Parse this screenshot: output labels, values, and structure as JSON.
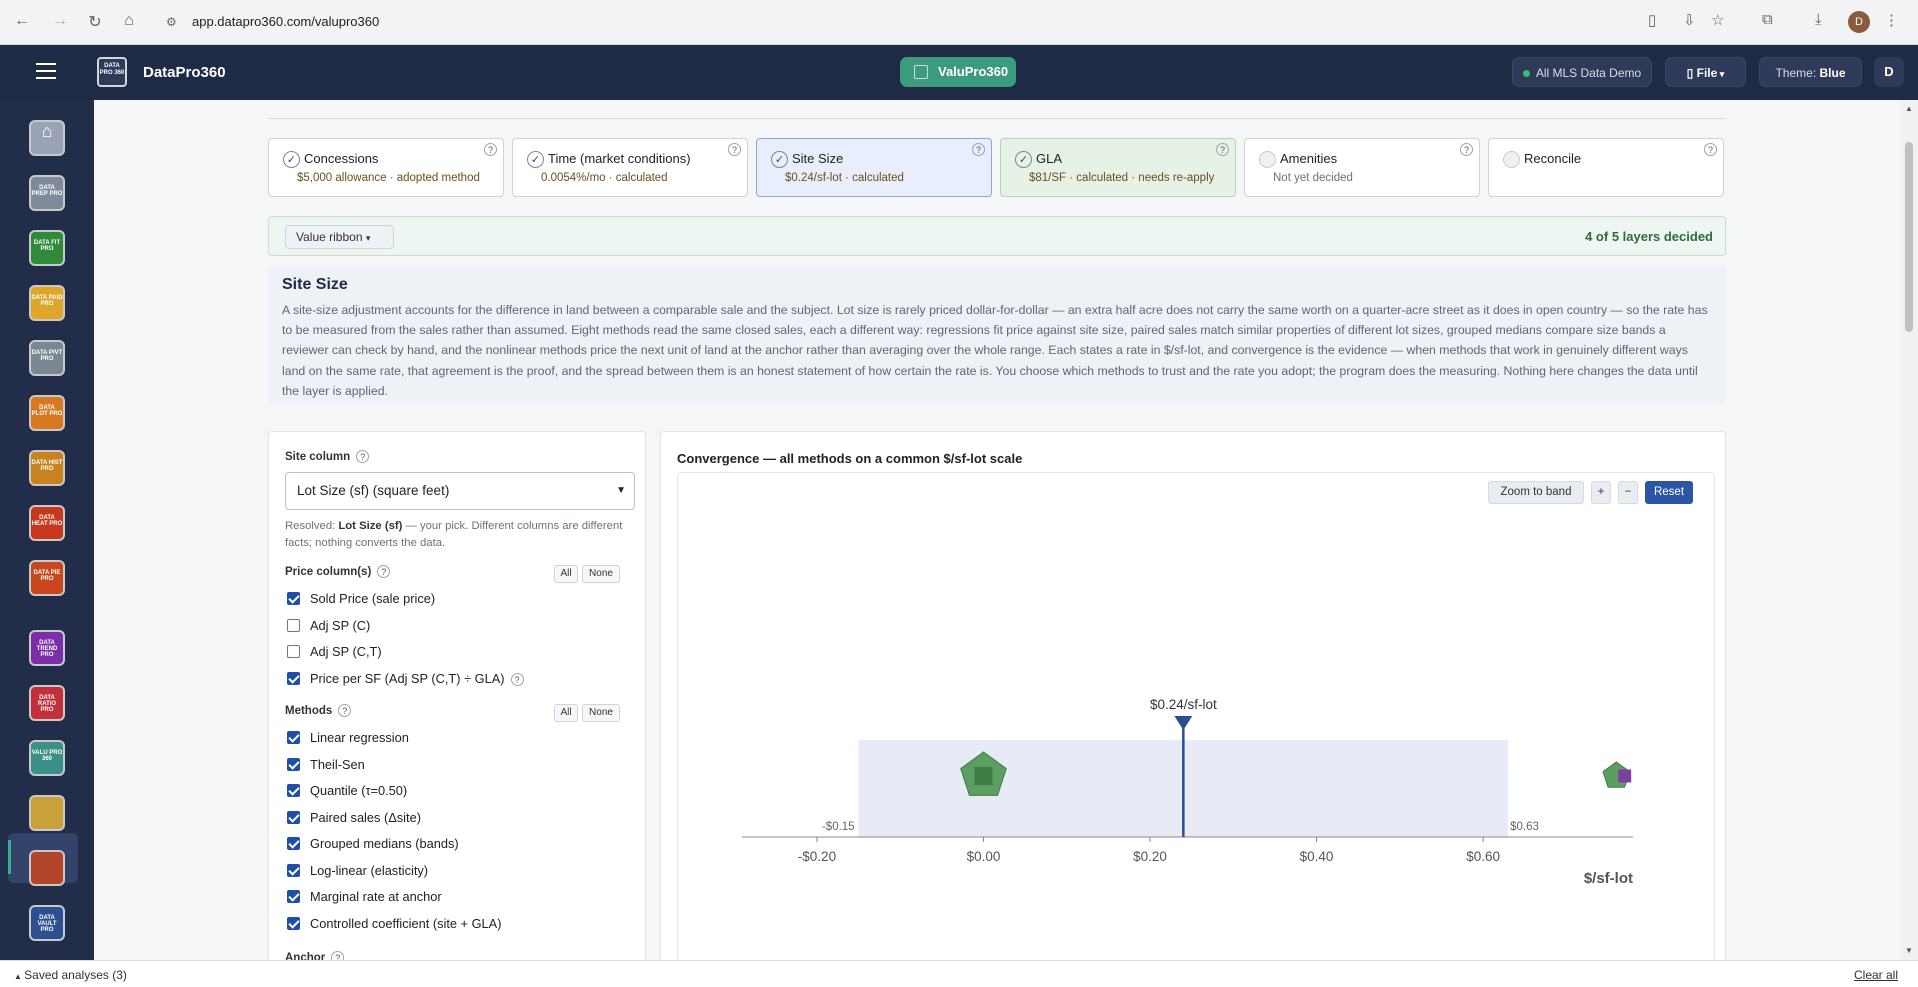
{
  "browser": {
    "url": "app.datapro360.com/valupro360"
  },
  "header": {
    "brand": "DataPro360",
    "logo_text": "DATA PRO 360",
    "active_app": "ValuPro360",
    "mls_label": "All MLS Data Demo",
    "file_label": "File",
    "theme_label": "Theme:",
    "theme_value": "Blue",
    "user_initial": "D"
  },
  "sidebar": {
    "items": [
      {
        "name": "home",
        "label": "",
        "color": "#9aa3b5"
      },
      {
        "name": "data-prep-pro",
        "label": "DATA PREP PRO",
        "color": "#7f8a9a"
      },
      {
        "name": "data-fit-pro",
        "label": "DATA FIT PRO",
        "color": "#2f8a3a"
      },
      {
        "name": "data-paid-pro",
        "label": "DATA PAID PRO",
        "color": "#e0a62a"
      },
      {
        "name": "data-pivt-pro",
        "label": "DATA PIVT PRO",
        "color": "#7a8690"
      },
      {
        "name": "data-plot-pro",
        "label": "DATA PLOT PRO",
        "color": "#d9791f"
      },
      {
        "name": "data-hist-pro",
        "label": "DATA HIST PRO",
        "color": "#c98220"
      },
      {
        "name": "data-heat-pro",
        "label": "DATA HEAT PRO",
        "color": "#c8381f"
      },
      {
        "name": "data-pie-pro",
        "label": "DATA PIE PRO",
        "color": "#c8471f"
      },
      {
        "name": "data-trend-pro",
        "label": "DATA TREND PRO",
        "color": "#7a2fa8"
      },
      {
        "name": "data-ratio-pro",
        "label": "DATA RATIO PRO",
        "color": "#c22f3a"
      },
      {
        "name": "valu-pro-360",
        "label": "VALU PRO 360",
        "color": "#3a8f86"
      },
      {
        "name": "grid-app",
        "label": "",
        "color": "#c9a03a"
      },
      {
        "name": "chart-app",
        "label": "",
        "color": "#b2452a"
      },
      {
        "name": "data-vault-pro",
        "label": "DATA VAULT PRO",
        "color": "#2c4f8f"
      }
    ]
  },
  "layers": [
    {
      "name": "Concessions",
      "status": "$5,000 allowance · adopted method",
      "decided": true
    },
    {
      "name": "Time (market conditions)",
      "status": "0.0054%/mo · calculated",
      "decided": true
    },
    {
      "name": "Site Size",
      "status": "$0.24/sf-lot · calculated",
      "decided": true
    },
    {
      "name": "GLA",
      "status": "$81/SF · calculated · needs re-apply",
      "decided": true
    },
    {
      "name": "Amenities",
      "status": "Not yet decided",
      "decided": false
    },
    {
      "name": "Reconcile",
      "status": "",
      "decided": false
    }
  ],
  "ribbon": {
    "button": "Value ribbon",
    "count": "4 of 5 layers decided"
  },
  "intro": {
    "title": "Site Size",
    "body": "A site-size adjustment accounts for the difference in land between a comparable sale and the subject. Lot size is rarely priced dollar-for-dollar — an extra half acre does not carry the same worth on a quarter-acre street as it does in open country — so the rate has to be measured from the sales rather than assumed. Eight methods read the same closed sales, each a different way: regressions fit price against site size, paired sales match similar properties of different lot sizes, grouped medians compare size bands a reviewer can check by hand, and the nonlinear methods price the next unit of land at the anchor rather than averaging over the whole range. Each states a rate in $/sf-lot, and convergence is the evidence — when methods that work in genuinely different ways land on the same rate, that agreement is the proof, and the spread between them is an honest statement of how certain the rate is. You choose which methods to trust and the rate you adopt; the program does the measuring. Nothing here changes the data until the layer is applied."
  },
  "controls": {
    "site_column_label": "Site column",
    "site_column_value": "Lot Size (sf) (square feet)",
    "resolved_prefix": "Resolved: ",
    "resolved_bold": "Lot Size (sf)",
    "resolved_rest": " — your pick. Different columns are different facts; nothing converts the data.",
    "price_label": "Price column(s)",
    "all": "All",
    "none": "None",
    "price_columns": [
      {
        "label": "Sold Price (sale price)",
        "checked": true
      },
      {
        "label": "Adj SP (C)",
        "checked": false
      },
      {
        "label": "Adj SP (C,T)",
        "checked": false
      },
      {
        "label": "Price per SF (Adj SP (C,T) ÷ GLA)",
        "checked": true
      }
    ],
    "methods_label": "Methods",
    "methods": [
      {
        "label": "Linear regression",
        "checked": true
      },
      {
        "label": "Theil-Sen",
        "checked": true
      },
      {
        "label": "Quantile (τ=0.50)",
        "checked": true
      },
      {
        "label": "Paired sales (Δsite)",
        "checked": true
      },
      {
        "label": "Grouped medians (bands)",
        "checked": true
      },
      {
        "label": "Log-linear (elasticity)",
        "checked": true
      },
      {
        "label": "Marginal rate at anchor",
        "checked": true
      },
      {
        "label": "Controlled coefficient (site + GLA)",
        "checked": true
      }
    ],
    "anchor_label": "Anchor"
  },
  "chart": {
    "title": "Convergence — all methods on a common $/sf-lot scale",
    "zoom_label": "Zoom to band",
    "plus": "+",
    "minus": "−",
    "reset": "Reset"
  },
  "chart_data": {
    "type": "scatter",
    "xlabel": "$/sf-lot",
    "xlim": [
      -0.29,
      0.78
    ],
    "ticks": [
      "-$0.20",
      "$0.00",
      "$0.20",
      "$0.40",
      "$0.60"
    ],
    "tick_values": [
      -0.2,
      0.0,
      0.2,
      0.4,
      0.6
    ],
    "band": {
      "low": -0.15,
      "high": 0.63,
      "low_label": "-$0.15",
      "high_label": "$0.63"
    },
    "adopted": {
      "value": 0.24,
      "label": "$0.24/sf-lot"
    },
    "points": [
      {
        "x": 0.0,
        "shape": "pentagon",
        "color": "#5b9e5f"
      },
      {
        "x": 0.0,
        "shape": "square",
        "color": "#3f7d47"
      },
      {
        "x": 0.76,
        "shape": "pentagon",
        "color": "#5b9e5f"
      },
      {
        "x": 0.77,
        "shape": "square",
        "color": "#7b3f9e"
      }
    ]
  },
  "footer": {
    "saved": "Saved analyses (3)",
    "clear": "Clear all"
  }
}
